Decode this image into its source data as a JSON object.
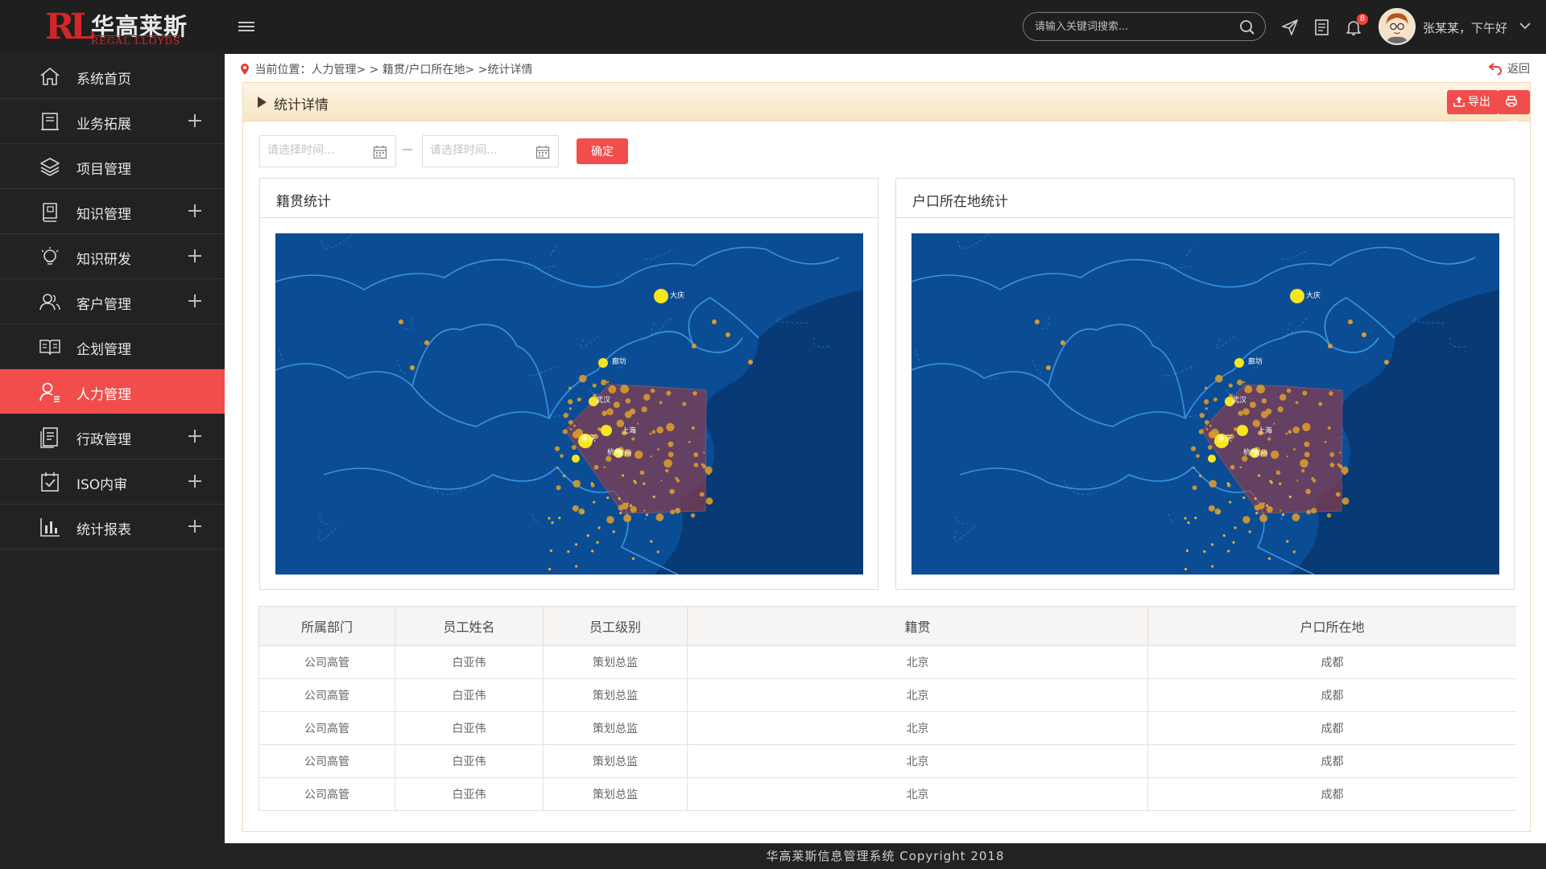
{
  "app": {
    "logo_letters": "RL",
    "logo_cn": "华高莱斯",
    "logo_en": "REGAL LLOYDS",
    "search_placeholder": "请输入关键词搜索...",
    "notification_count": "8",
    "greeting": "张某某，下午好",
    "accent_color": "#f04d4b"
  },
  "sidebar": {
    "items": [
      {
        "label": "系统首页",
        "icon": "home-icon",
        "expandable": false
      },
      {
        "label": "业务拓展",
        "icon": "business-expand-icon",
        "expandable": true
      },
      {
        "label": "项目管理",
        "icon": "layers-icon",
        "expandable": false
      },
      {
        "label": "知识管理",
        "icon": "book-icon",
        "expandable": true
      },
      {
        "label": "知识研发",
        "icon": "lightbulb-icon",
        "expandable": true
      },
      {
        "label": "客户管理",
        "icon": "users-icon",
        "expandable": true
      },
      {
        "label": "企划管理",
        "icon": "open-book-icon",
        "expandable": false
      },
      {
        "label": "人力管理",
        "icon": "user-list-icon",
        "expandable": false,
        "active": true
      },
      {
        "label": "行政管理",
        "icon": "document-icon",
        "expandable": true
      },
      {
        "label": "ISO内审",
        "icon": "checkbox-icon",
        "expandable": true
      },
      {
        "label": "统计报表",
        "icon": "bar-chart-icon",
        "expandable": true
      }
    ]
  },
  "breadcrumb": {
    "text": "当前位置：人力管理> > 籍贯/户口所在地> >统计详情",
    "back_label": "返回"
  },
  "panel": {
    "title": "统计详情",
    "export_label": "导出",
    "print_label": "打印"
  },
  "filter": {
    "start_placeholder": "请选择时间...",
    "end_placeholder": "请选择时间...",
    "separator": "—",
    "confirm_label": "确定"
  },
  "maps": {
    "native_title": "籍贯统计",
    "household_title": "户口所在地统计",
    "city_labels": [
      "大庆",
      "廊坊",
      "武汉",
      "上海",
      "苏州",
      "重庆",
      "杭州"
    ]
  },
  "table": {
    "headers": [
      "所属部门",
      "员工姓名",
      "员工级别",
      "籍贯",
      "户口所在地"
    ],
    "rows": [
      [
        "公司高管",
        "白亚伟",
        "策划总监",
        "北京",
        "成都"
      ],
      [
        "公司高管",
        "白亚伟",
        "策划总监",
        "北京",
        "成都"
      ],
      [
        "公司高管",
        "白亚伟",
        "策划总监",
        "北京",
        "成都"
      ],
      [
        "公司高管",
        "白亚伟",
        "策划总监",
        "北京",
        "成都"
      ],
      [
        "公司高管",
        "白亚伟",
        "策划总监",
        "北京",
        "成都"
      ]
    ]
  },
  "footer": {
    "text": "华高莱斯信息管理系统    Copyright  2018"
  }
}
